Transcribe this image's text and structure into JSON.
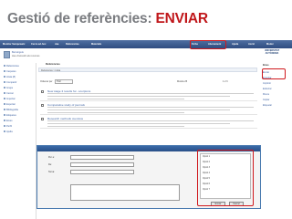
{
  "slide": {
    "title_prefix": "Gestió de referències: ",
    "title_accent": "ENVIAR"
  },
  "colors": {
    "title_gray": "#7a7c80",
    "accent_red": "#c0171b",
    "nav_blue": "#2e4c80",
    "highlight_red": "#d0191e"
  },
  "app": {
    "nav_items": [
      "Monitor Sempewetc",
      "Cerca ad-hoc",
      "Jaa",
      "Referencias",
      "Materials",
      "Ficha",
      "Abonament",
      "Ajuda",
      "Acció",
      "Moder"
    ],
    "brand_line1": "UNIVERSITAT",
    "brand_line2": "AUTÒNOMA",
    "message_line1": "Benvinguts",
    "message_line2": "Heu d'accedir als recursos"
  },
  "sidebar": {
    "items": [
      {
        "label": "Referències"
      },
      {
        "label": "Carpetes"
      },
      {
        "label": "Llista (8)"
      },
      {
        "label": "Compartir"
      },
      {
        "label": "Grups"
      },
      {
        "label": "Cercar"
      },
      {
        "label": "Importar"
      },
      {
        "label": "Exportar"
      },
      {
        "label": "Bibliografia"
      },
      {
        "label": "Etiquetes"
      },
      {
        "label": "Eines"
      },
      {
        "label": "Perfil"
      },
      {
        "label": "Ajuda"
      }
    ]
  },
  "content": {
    "header": "Referències",
    "breadcrumb": "Referències > Llista",
    "toolbar": {
      "sort_label": "Ordenar per",
      "sort_value": "Títol",
      "show_label": "Mostra 25",
      "pages": "1 2 3"
    },
    "rows": [
      {
        "title": "New stage 2 results for...scorpions"
      },
      {
        "title": "Comparative study of journals"
      },
      {
        "title": "Research methods overview"
      }
    ]
  },
  "dialog": {
    "fields": [
      {
        "label": "Per a:",
        "value": ""
      },
      {
        "label": "De:",
        "value": ""
      },
      {
        "label": "Tema:",
        "value": ""
      }
    ],
    "options": [
      "Opció 1",
      "Opció 2",
      "Opció 3",
      "Opció 4",
      "Opció 5",
      "Opció 6",
      "Opció 7"
    ],
    "send_label": "Enviar",
    "cancel_label": "Cancel"
  },
  "rightpanel": {
    "items": [
      "Eines",
      "Enviar",
      "Exportar",
      "Imprimir",
      "Esborrar",
      "Moure",
      "Copiar",
      "Etiquetar"
    ]
  }
}
